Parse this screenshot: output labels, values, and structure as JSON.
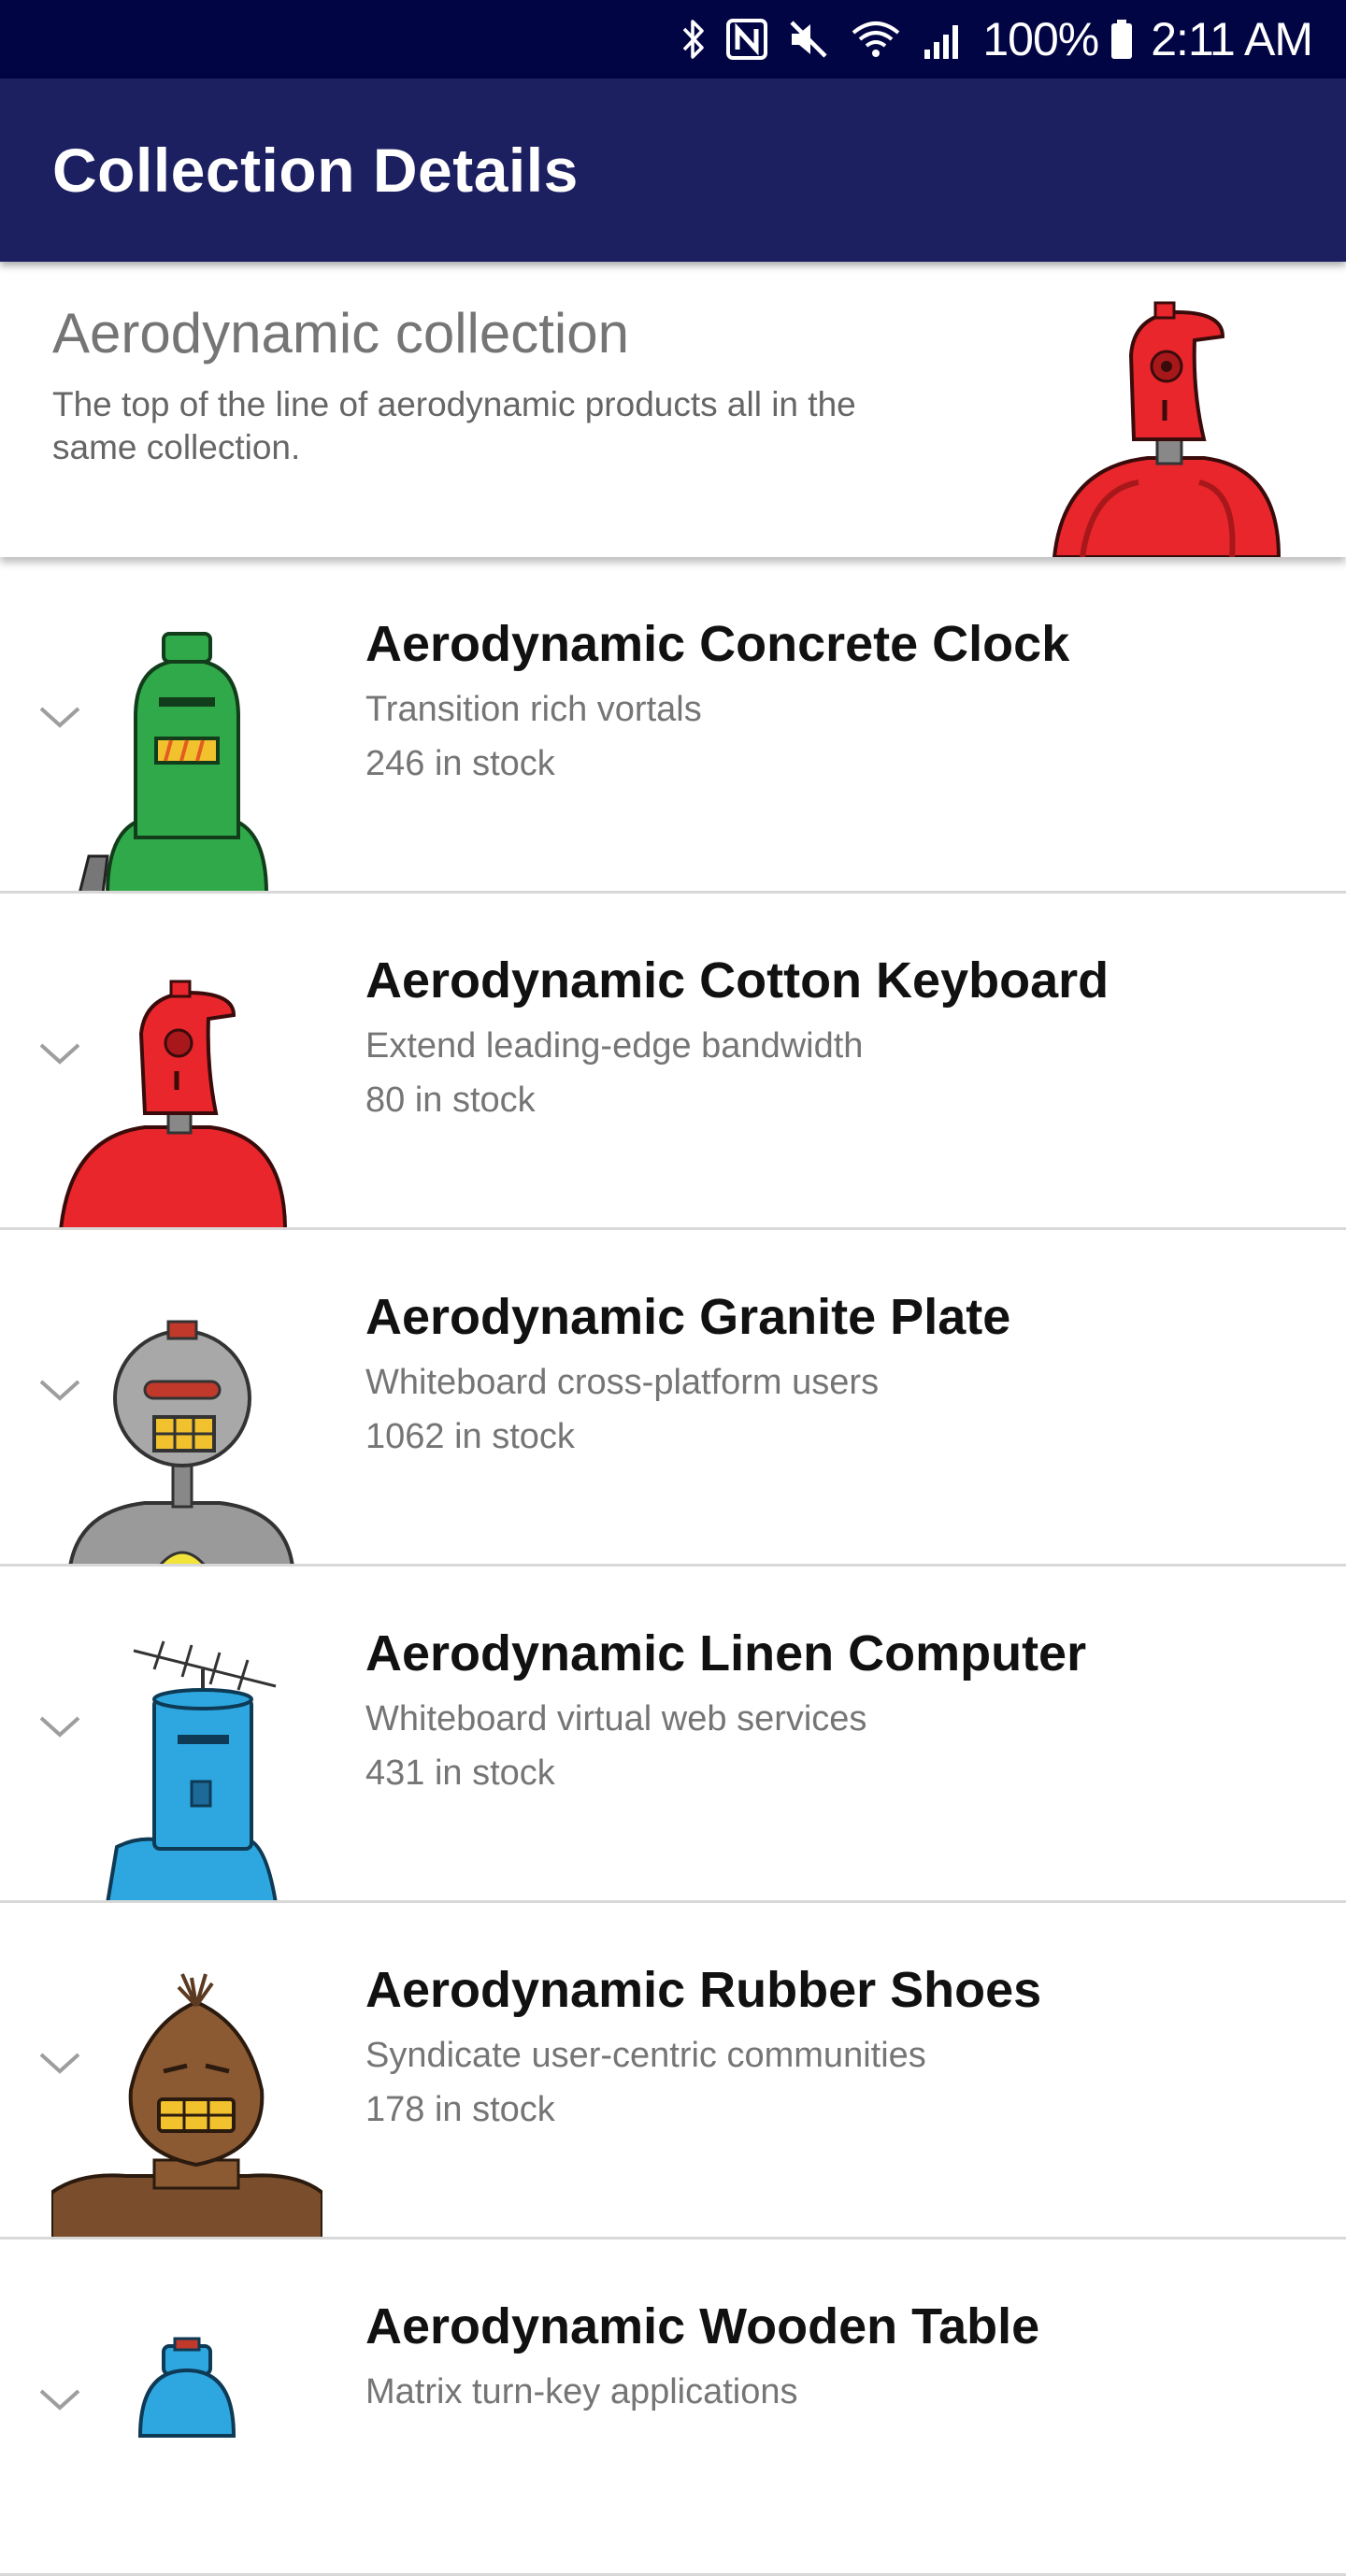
{
  "status_bar": {
    "icons": [
      "bluetooth-icon",
      "nfc-icon",
      "mute-icon",
      "wifi-icon",
      "signal-icon",
      "battery-icon"
    ],
    "battery": "100%",
    "time": "2:11 AM"
  },
  "app_bar": {
    "title": "Collection Details"
  },
  "collection": {
    "name": "Aerodynamic collection",
    "description": "The top of the line of aerodynamic products all in the same collection.",
    "image": "red-robot-image"
  },
  "products": [
    {
      "name": "Aerodynamic Concrete Clock",
      "description": "Transition rich vortals",
      "stock": "246 in stock",
      "image": "green-robot-image"
    },
    {
      "name": "Aerodynamic Cotton Keyboard",
      "description": "Extend leading-edge bandwidth",
      "stock": "80 in stock",
      "image": "red-robot-image"
    },
    {
      "name": "Aerodynamic Granite Plate",
      "description": "Whiteboard cross-platform users",
      "stock": "1062 in stock",
      "image": "grey-robot-image"
    },
    {
      "name": "Aerodynamic Linen Computer",
      "description": "Whiteboard virtual web services",
      "stock": "431 in stock",
      "image": "blue-robot-image"
    },
    {
      "name": "Aerodynamic Rubber Shoes",
      "description": "Syndicate user-centric communities",
      "stock": "178 in stock",
      "image": "brown-robot-image"
    },
    {
      "name": "Aerodynamic Wooden Table",
      "description": "Matrix turn-key applications",
      "stock": "",
      "image": "blue-robot-image"
    }
  ],
  "colors": {
    "status_bar": "#020544",
    "app_bar": "#1c2060",
    "divider": "#d8d8d8",
    "secondary_text": "#757575"
  }
}
